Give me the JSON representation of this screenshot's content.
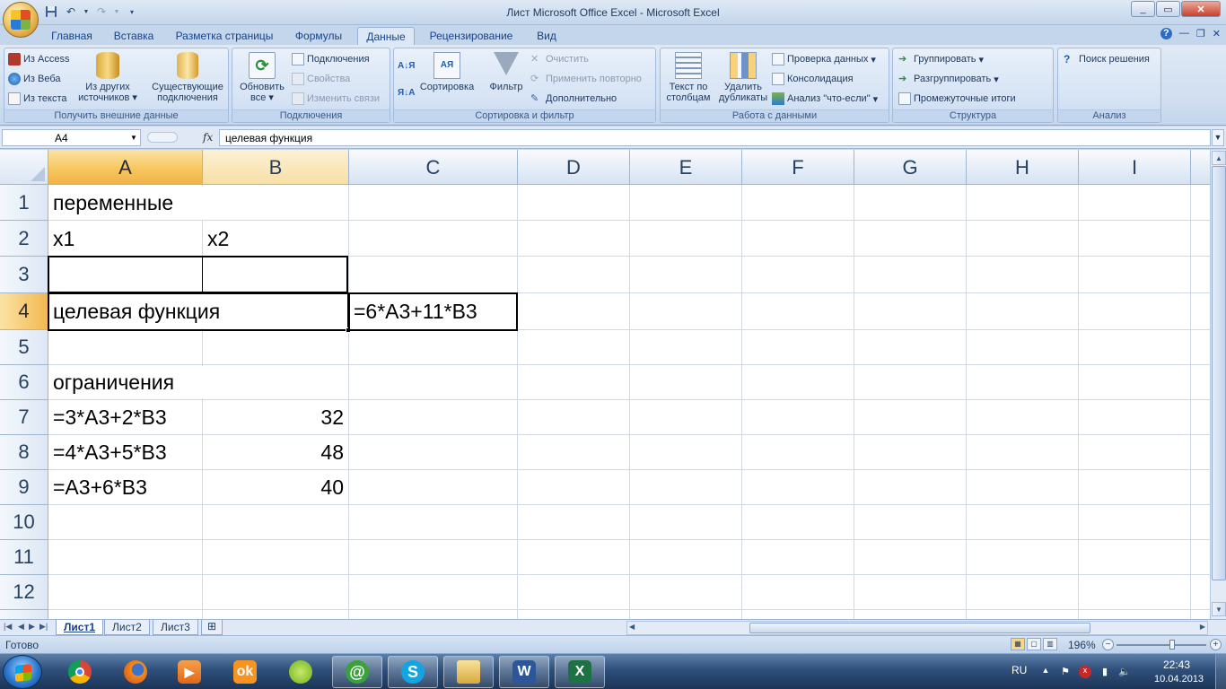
{
  "window": {
    "title": "Лист Microsoft Office Excel - Microsoft Excel",
    "minimize": "_",
    "maximize": "▭",
    "close": "✕"
  },
  "ribbon_tabs": [
    "Главная",
    "Вставка",
    "Разметка страницы",
    "Формулы",
    "Данные",
    "Рецензирование",
    "Вид"
  ],
  "active_tab": "Данные",
  "groups": {
    "external_data": {
      "label": "Получить внешние данные",
      "from_access": "Из Access",
      "from_web": "Из Веба",
      "from_text": "Из текста",
      "from_other": "Из других источников",
      "existing": "Существующие подключения"
    },
    "connections": {
      "label": "Подключения",
      "refresh_all": "Обновить все",
      "connections": "Подключения",
      "properties": "Свойства",
      "edit_links": "Изменить связи"
    },
    "sort_filter": {
      "label": "Сортировка и фильтр",
      "sort": "Сортировка",
      "filter": "Фильтр",
      "clear": "Очистить",
      "reapply": "Применить повторно",
      "advanced": "Дополнительно"
    },
    "data_tools": {
      "label": "Работа с данными",
      "text_to_columns": "Текст по столбцам",
      "remove_duplicates": "Удалить дубликаты",
      "validation": "Проверка данных",
      "consolidate": "Консолидация",
      "what_if": "Анализ \"что-если\""
    },
    "outline": {
      "label": "Структура",
      "group": "Группировать",
      "ungroup": "Разгруппировать",
      "subtotal": "Промежуточные итоги"
    },
    "analysis": {
      "label": "Анализ",
      "solver": "Поиск решения"
    }
  },
  "formula_bar": {
    "name_box": "A4",
    "fx": "fx",
    "formula": "целевая функция"
  },
  "columns": [
    "A",
    "B",
    "C",
    "D",
    "E",
    "F",
    "G",
    "H",
    "I"
  ],
  "selected_column": "A",
  "rows": [
    "1",
    "2",
    "3",
    "4",
    "5",
    "6",
    "7",
    "8",
    "9",
    "10",
    "11",
    "12"
  ],
  "selected_row": "4",
  "cells": {
    "A1": "переменные",
    "A2": "x1",
    "B2": "x2",
    "A4": "целевая функция",
    "C4": "=6*A3+11*B3",
    "A6": "ограничения",
    "A7": "=3*A3+2*B3",
    "B7": "32",
    "A8": "=4*A3+5*B3",
    "B8": "48",
    "A9": "=A3+6*B3",
    "B9": "40"
  },
  "sheets": [
    "Лист1",
    "Лист2",
    "Лист3"
  ],
  "active_sheet": "Лист1",
  "status": {
    "ready": "Готово",
    "zoom": "196%"
  },
  "taskbar": {
    "language": "RU",
    "time": "22:43",
    "date": "10.04.2013",
    "apps": [
      "chrome-icon",
      "firefox-icon",
      "media-player-icon",
      "odnoklassniki-icon",
      "mail-agent-icon",
      "mail-at-icon",
      "skype-icon",
      "explorer-icon",
      "word-icon",
      "excel-icon"
    ]
  }
}
